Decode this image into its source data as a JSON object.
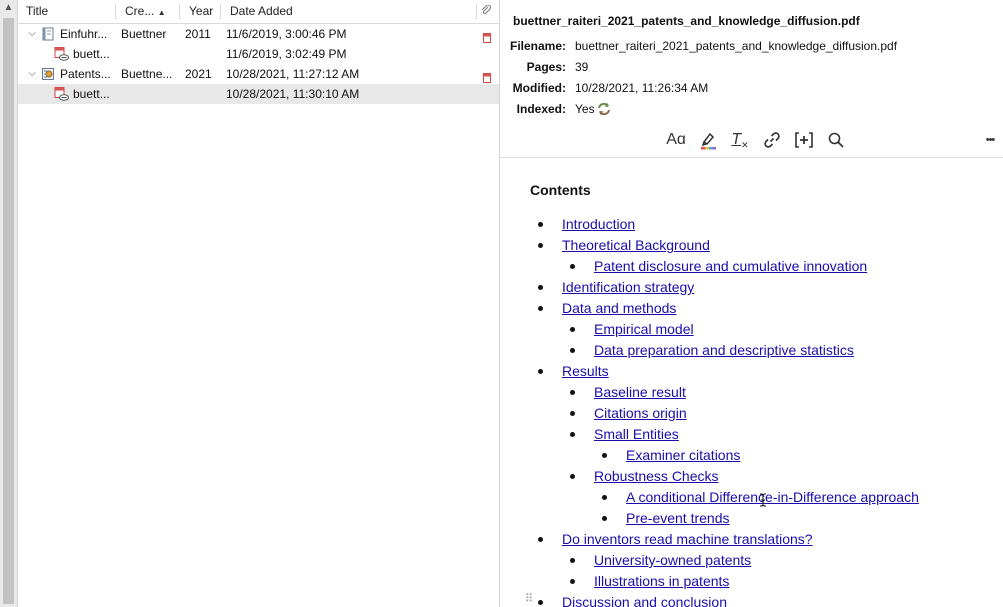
{
  "tree": {
    "columns": {
      "title": "Title",
      "creator": "Cre...",
      "year": "Year",
      "date_added": "Date Added"
    },
    "rows": [
      {
        "title": "Einfuhr...",
        "creator": "Buettner",
        "year": "2011",
        "date": "11/6/2019, 3:00:46 PM"
      },
      {
        "title": "buett...",
        "creator": "",
        "year": "",
        "date": "11/6/2019, 3:02:49 PM"
      },
      {
        "title": "Patents...",
        "creator": "Buettne...",
        "year": "2021",
        "date": "10/28/2021, 11:27:12 AM"
      },
      {
        "title": "buett...",
        "creator": "",
        "year": "",
        "date": "10/28/2021, 11:30:10 AM"
      }
    ]
  },
  "attachment": {
    "file_title": "buettner_raiteri_2021_patents_and_knowledge_diffusion.pdf",
    "filename_label": "Filename:",
    "filename": "buettner_raiteri_2021_patents_and_knowledge_diffusion.pdf",
    "pages_label": "Pages:",
    "pages": "39",
    "modified_label": "Modified:",
    "modified": "10/28/2021, 11:26:34 AM",
    "indexed_label": "Indexed:",
    "indexed": "Yes"
  },
  "toolbar": {
    "text_format": "Aɑ",
    "clear_format": "T",
    "more": "•••"
  },
  "notes": {
    "heading": "Contents",
    "toc": [
      {
        "text": "Introduction",
        "level": 0
      },
      {
        "text": "Theoretical Background",
        "level": 0
      },
      {
        "text": "Patent disclosure and cumulative innovation",
        "level": 1
      },
      {
        "text": "Identification strategy",
        "level": 0
      },
      {
        "text": "Data and methods",
        "level": 0
      },
      {
        "text": "Empirical model",
        "level": 1
      },
      {
        "text": "Data preparation and descriptive statistics",
        "level": 1
      },
      {
        "text": "Results",
        "level": 0
      },
      {
        "text": "Baseline result",
        "level": 1
      },
      {
        "text": "Citations origin",
        "level": 1
      },
      {
        "text": "Small Entities",
        "level": 1
      },
      {
        "text": "Examiner citations",
        "level": 2
      },
      {
        "text": "Robustness Checks",
        "level": 1
      },
      {
        "text": "A conditional Difference-in-Difference approach",
        "level": 2
      },
      {
        "text": "Pre-event trends",
        "level": 2
      },
      {
        "text": "Do inventors read machine translations?",
        "level": 0
      },
      {
        "text": "University-owned patents",
        "level": 1
      },
      {
        "text": "Illustrations in patents",
        "level": 1
      },
      {
        "text": "Discussion and conclusion",
        "level": 0
      }
    ]
  }
}
